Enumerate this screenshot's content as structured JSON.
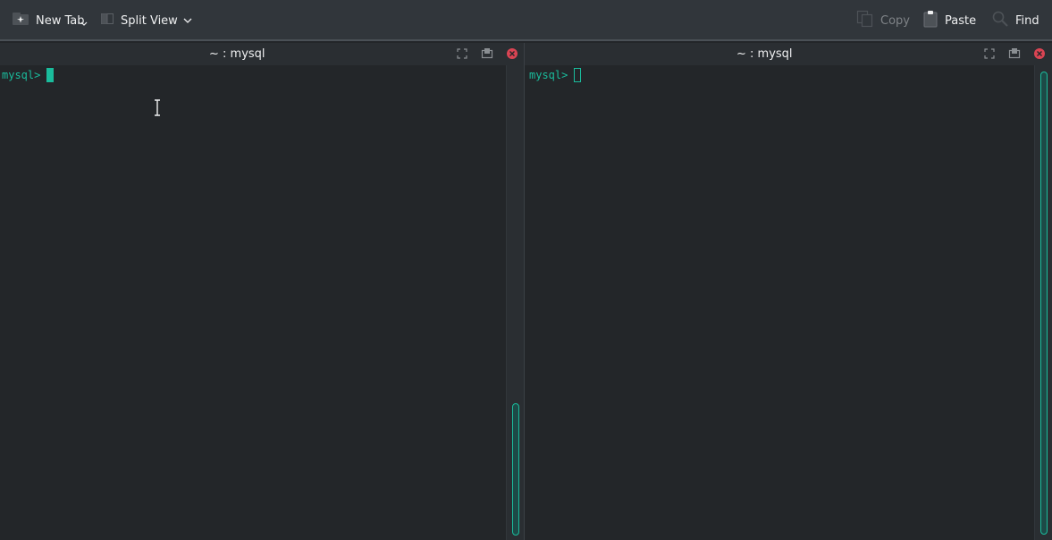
{
  "toolbar": {
    "new_tab_label": "New Tab",
    "split_view_label": "Split View",
    "copy_label": "Copy",
    "paste_label": "Paste",
    "find_label": "Find"
  },
  "panes": [
    {
      "title": "~ : mysql",
      "prompt": "mysql>",
      "cursor": "block",
      "active": true
    },
    {
      "title": "~ : mysql",
      "prompt": "mysql>",
      "cursor": "hollow",
      "active": false
    }
  ],
  "icons": {
    "new_tab": "new-tab-icon",
    "split_view": "split-view-icon",
    "copy": "copy-icon",
    "paste": "paste-icon",
    "find": "search-icon",
    "maximize": "maximize-icon",
    "detach": "detach-icon",
    "close": "close-icon"
  },
  "colors": {
    "background": "#232629",
    "toolbar": "#31363b",
    "accent": "#1abc9c",
    "close": "#da4453",
    "text": "#eff0f1",
    "disabled_text": "#7f8387"
  }
}
